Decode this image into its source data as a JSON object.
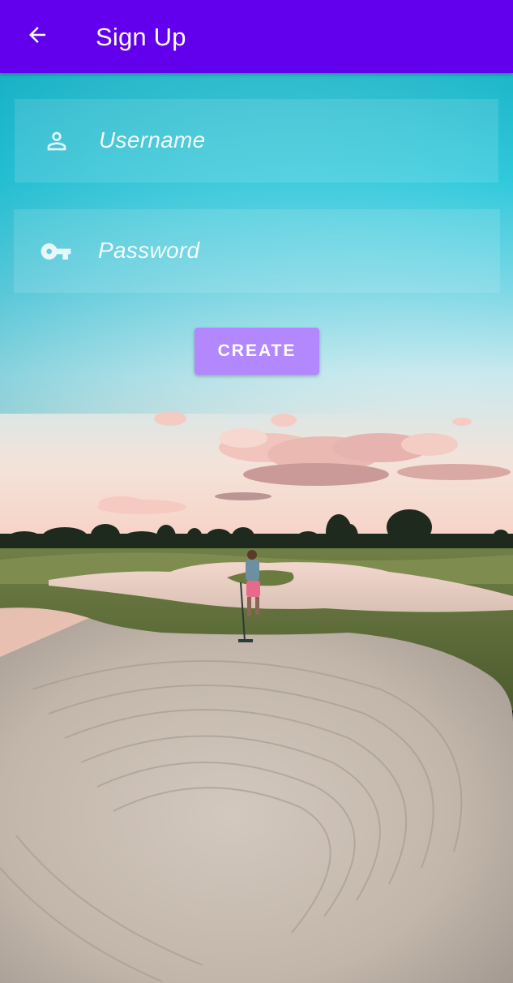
{
  "appbar": {
    "title": "Sign Up",
    "back_icon": "arrow-back-icon",
    "color": "#6200EE"
  },
  "form": {
    "username": {
      "placeholder": "Username",
      "icon": "person-icon"
    },
    "password": {
      "placeholder": "Password",
      "icon": "key-icon"
    },
    "create_label": "CREATE",
    "create_color": "#B388FF"
  },
  "background": {
    "icon": "golf-course-sand-bunker-image"
  }
}
